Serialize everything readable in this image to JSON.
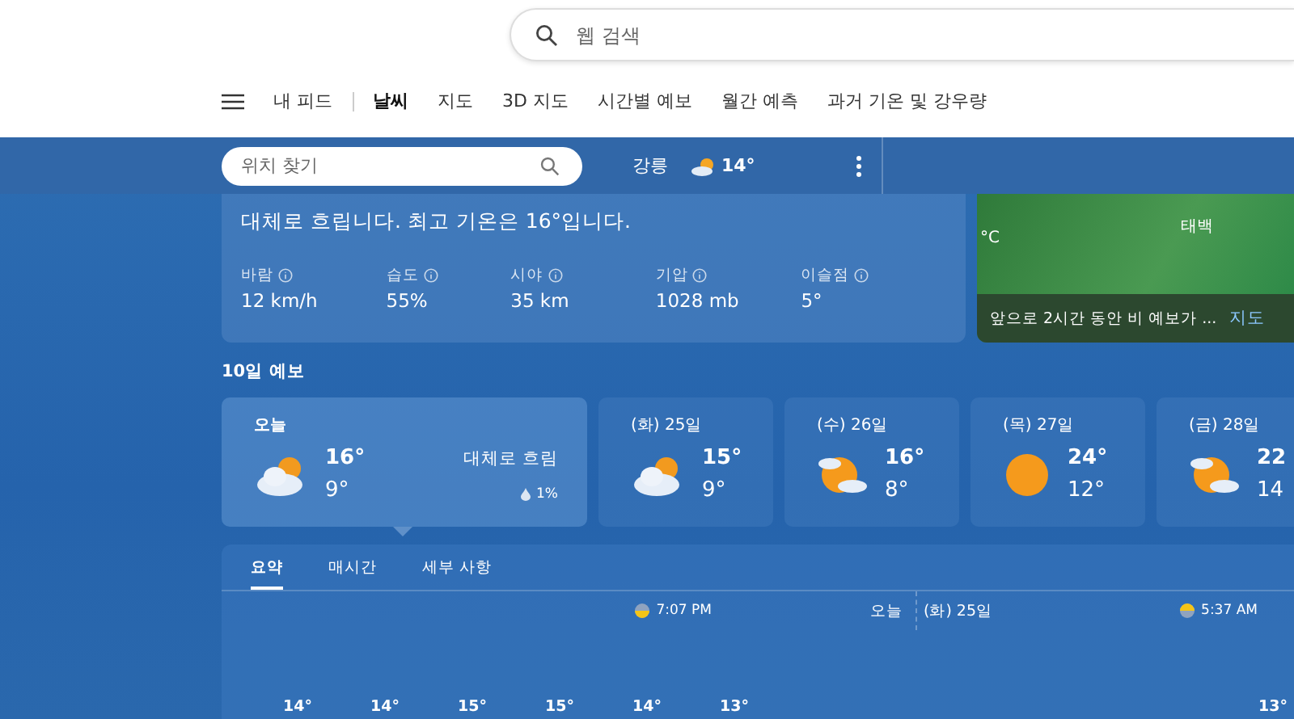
{
  "search": {
    "placeholder": "웹 검색"
  },
  "nav": [
    {
      "label": "내 피드",
      "selected": false
    },
    {
      "label": "날씨",
      "selected": true
    },
    {
      "label": "지도",
      "selected": false
    },
    {
      "label": "3D 지도",
      "selected": false
    },
    {
      "label": "시간별 예보",
      "selected": false
    },
    {
      "label": "월간 예측",
      "selected": false
    },
    {
      "label": "과거 기온 및 강우량",
      "selected": false
    }
  ],
  "location_search": {
    "placeholder": "위치 찾기"
  },
  "current": {
    "location": "강릉",
    "temp": "14°",
    "kind": "partly-cloudy"
  },
  "summary": {
    "text": "대체로 흐립니다. 최고 기온은 16°입니다.",
    "stats": [
      {
        "label": "바람",
        "value": "12 km/h"
      },
      {
        "label": "습도",
        "value": "55%"
      },
      {
        "label": "시야",
        "value": "35 km"
      },
      {
        "label": "기압",
        "value": "1028 mb"
      },
      {
        "label": "이슬점",
        "value": "5°"
      }
    ]
  },
  "map": {
    "labels": [
      "°C",
      "태백"
    ],
    "caption": "앞으로 2시간 동안 비 예보가 ...",
    "link": "지도"
  },
  "forecast": {
    "title": "10일 예보",
    "days": [
      {
        "day": "오늘",
        "high": "16°",
        "low": "9°",
        "kind": "partly-cloudy",
        "condition": "대체로 흐림",
        "precip": "1%",
        "selected": true
      },
      {
        "day": "(화) 25일",
        "high": "15°",
        "low": "9°",
        "kind": "partly-cloudy",
        "selected": false
      },
      {
        "day": "(수) 26일",
        "high": "16°",
        "low": "8°",
        "kind": "sun-clouds",
        "selected": false
      },
      {
        "day": "(목) 27일",
        "high": "24°",
        "low": "12°",
        "kind": "sun",
        "selected": false
      },
      {
        "day": "(금) 28일",
        "high": "22",
        "low": "14",
        "kind": "sun-clouds",
        "selected": false
      }
    ]
  },
  "details": {
    "tabs": [
      {
        "label": "요약",
        "selected": true
      },
      {
        "label": "매시간",
        "selected": false
      },
      {
        "label": "세부 사항",
        "selected": false
      }
    ],
    "sunset": "7:07 PM",
    "today": "오늘",
    "next_day": "(화) 25일",
    "sunrise": "5:37 AM",
    "temps": [
      "14°",
      "14°",
      "15°",
      "15°",
      "14°",
      "13°"
    ],
    "next_temp": "13°"
  }
}
